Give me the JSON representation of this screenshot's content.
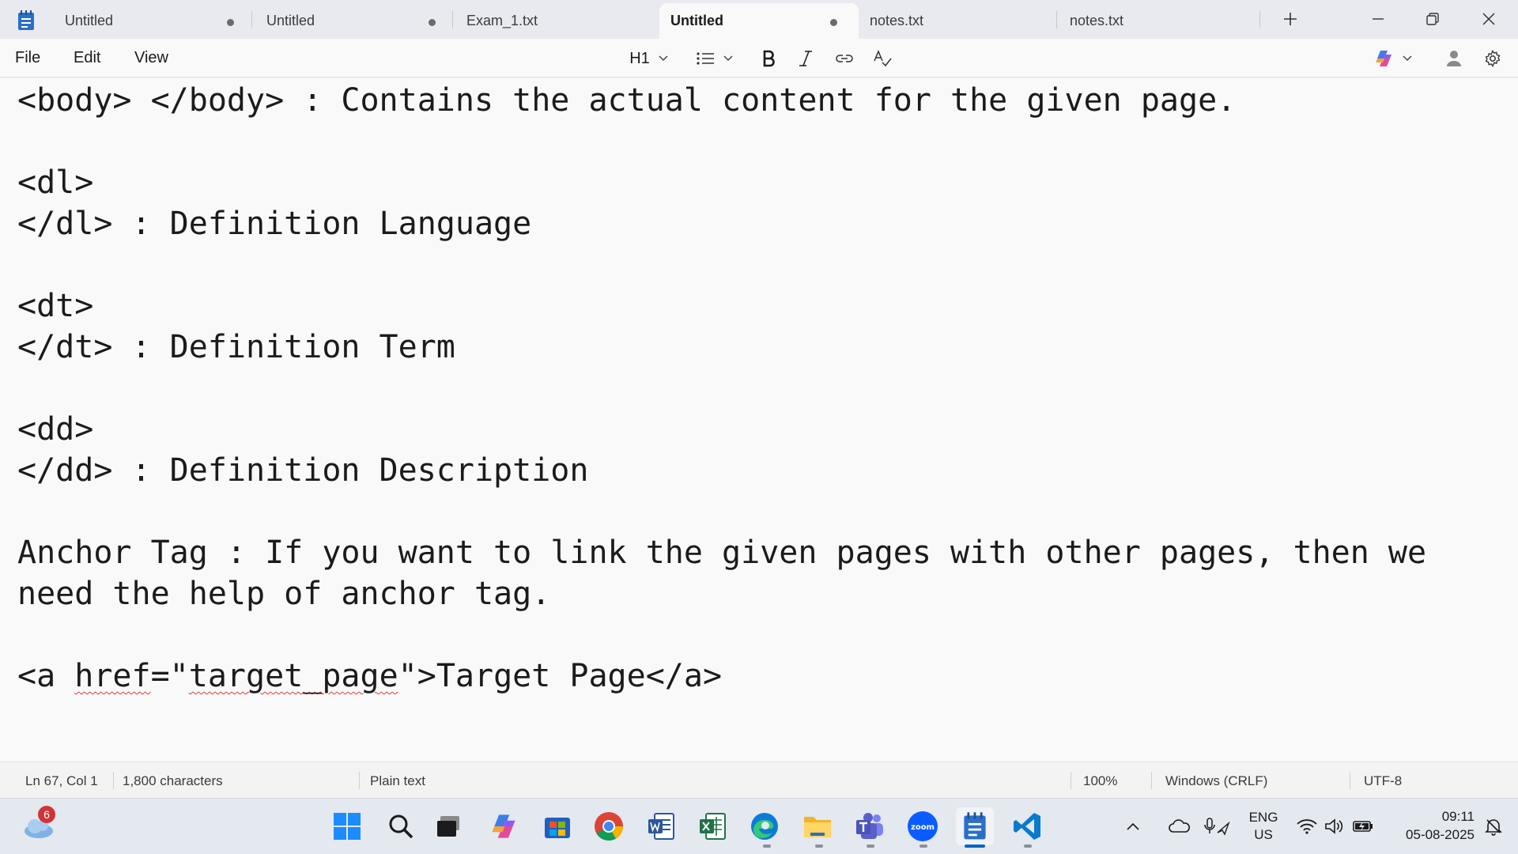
{
  "tabs": [
    {
      "label": "Untitled",
      "modified": true
    },
    {
      "label": "Untitled",
      "modified": true
    },
    {
      "label": "Exam_1.txt",
      "modified": false
    },
    {
      "label": "Untitled",
      "modified": true,
      "active": true
    },
    {
      "label": "notes.txt",
      "modified": false
    },
    {
      "label": "notes.txt",
      "modified": false
    }
  ],
  "menu": {
    "file": "File",
    "edit": "Edit",
    "view": "View"
  },
  "toolbar": {
    "heading": "H1"
  },
  "editor": {
    "lines": [
      "<body> </body> : Contains the actual content for the given page.",
      "",
      "<dl>",
      "</dl> : Definition Language",
      "",
      "<dt>",
      "</dt> : Definition Term",
      "",
      "<dd>",
      "</dd> : Definition Description",
      "",
      "Anchor Tag : If you want to link the given pages with other pages, then we",
      "need the help of anchor tag.",
      "",
      "<a href=\"target_page\">Target Page</a>"
    ],
    "anchor_line": {
      "p1": "<a ",
      "p2": "href",
      "p3": "=\"",
      "p4": "target_page",
      "p5": "\">Target Page</a>"
    }
  },
  "status": {
    "position": "Ln 67, Col 1",
    "characters": "1,800 characters",
    "format": "Plain text",
    "zoom": "100%",
    "line_ending": "Windows (CRLF)",
    "encoding": "UTF-8"
  },
  "taskbar": {
    "weather_badge": "6",
    "lang_top": "ENG",
    "lang_bottom": "US",
    "time": "09:11",
    "date": "05-08-2025"
  },
  "colors": {
    "accent": "#0067c0",
    "spell_error": "#d83b3b",
    "notepad_icon": "#2b6fc7"
  }
}
